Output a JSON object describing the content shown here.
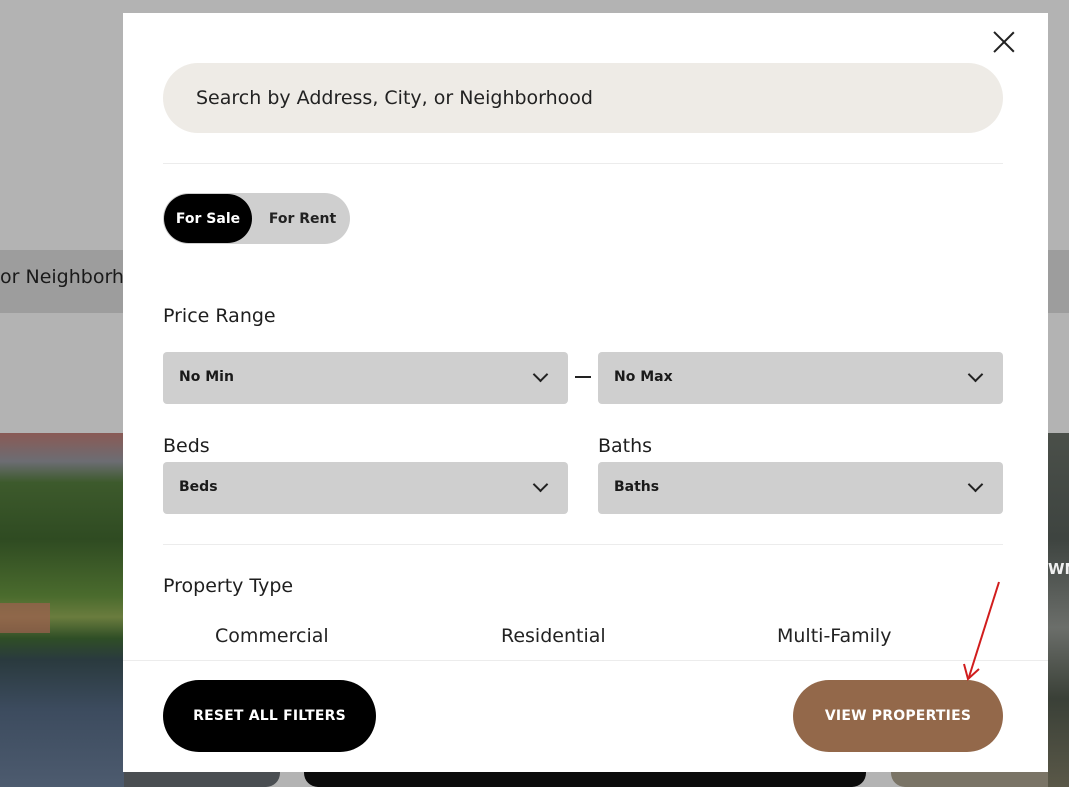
{
  "background": {
    "search_partial": "or Neighborhood",
    "map_partial": "WM"
  },
  "modal": {
    "search": {
      "placeholder": "Search by Address, City, or Neighborhood"
    },
    "listing_toggle": {
      "for_sale": "For Sale",
      "for_rent": "For Rent",
      "selected": "For Sale"
    },
    "price_range": {
      "label": "Price Range",
      "min": "No Min",
      "max": "No Max"
    },
    "beds": {
      "label": "Beds",
      "value": "Beds"
    },
    "baths": {
      "label": "Baths",
      "value": "Baths"
    },
    "property_type": {
      "label": "Property Type",
      "options": [
        "Commercial",
        "Residential",
        "Multi-Family"
      ]
    },
    "footer": {
      "reset_label": "RESET ALL FILTERS",
      "view_label": "VIEW PROPERTIES"
    }
  },
  "colors": {
    "accent_brown": "#93684a",
    "search_bg": "#eeebe6",
    "select_bg": "#cfcfcf",
    "annotation_red": "#d11d1d"
  },
  "icons": {
    "close": "close-icon",
    "chevron": "chevron-down-icon"
  }
}
